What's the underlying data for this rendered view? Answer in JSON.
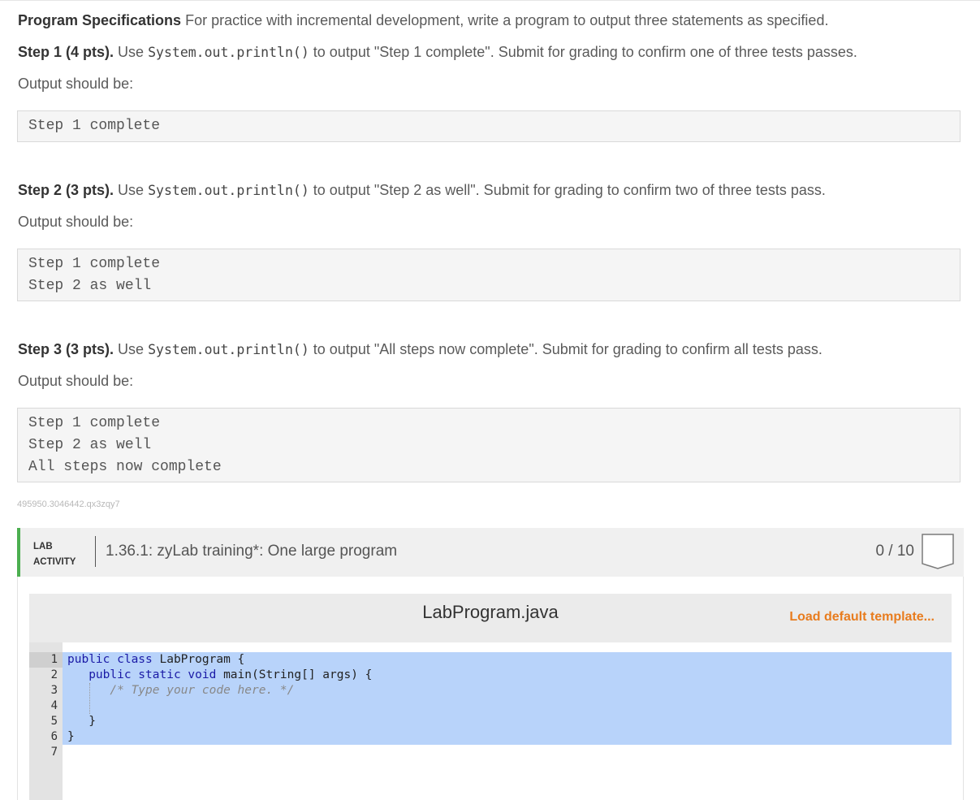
{
  "spec": {
    "title": "Program Specifications",
    "intro": "For practice with incremental development, write a program to output three statements as specified.",
    "output_label": "Output should be:",
    "steps": [
      {
        "label": "Step 1 (4 pts).",
        "pre": "Use",
        "code": "System.out.println()",
        "post": "to output \"Step 1 complete\". Submit for grading to confirm one of three tests passes.",
        "output": [
          "Step 1 complete"
        ]
      },
      {
        "label": "Step 2 (3 pts).",
        "pre": "Use",
        "code": "System.out.println()",
        "post": "to output \"Step 2 as well\". Submit for grading to confirm two of three tests pass.",
        "output": [
          "Step 1 complete",
          "Step 2 as well"
        ]
      },
      {
        "label": "Step 3 (3 pts).",
        "pre": "Use",
        "code": "System.out.println()",
        "post": "to output \"All steps now complete\". Submit for grading to confirm all tests pass.",
        "output": [
          "Step 1 complete",
          "Step 2 as well",
          "All steps now complete"
        ]
      }
    ],
    "hash": "495950.3046442.qx3zqy7"
  },
  "lab": {
    "tag_line1": "LAB",
    "tag_line2": "ACTIVITY",
    "title": "1.36.1: zyLab training*: One large program",
    "score": "0 / 10",
    "accent": "#4caf50"
  },
  "editor": {
    "filename": "LabProgram.java",
    "load_button": "Load default template...",
    "line_numbers": [
      "1",
      "2",
      "3",
      "4",
      "5",
      "6",
      "7"
    ],
    "code": {
      "l1_kw": "public class",
      "l1_rest": " LabProgram {",
      "l2_kw": "public static void",
      "l2_rest": " main(String[] args) {",
      "l3_comment": "/* Type your code here. */",
      "l5": "}",
      "l6": "}"
    },
    "selection_color": "#b8d3fa",
    "load_color": "#e87c1e"
  }
}
